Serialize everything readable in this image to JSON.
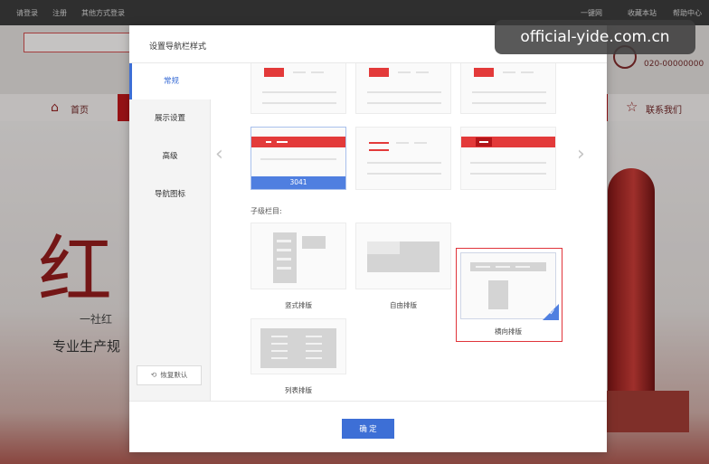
{
  "background_page": {
    "topbar_links": [
      "请登录",
      "注册",
      "其他方式登录"
    ],
    "topbar_right": [
      "一键网",
      "收藏本站",
      "帮助中心"
    ],
    "phone": "020-00000000",
    "nav_home": "首页",
    "nav_contact": "联系我们",
    "hero_calligraphy": "红",
    "hero_tagline": "一社红",
    "hero_subtitle": "专业生产规"
  },
  "dialog": {
    "title": "设置导航栏样式",
    "sidebar": {
      "items": [
        "常规",
        "展示设置",
        "高级",
        "导航图标"
      ],
      "active_index": 0,
      "reset_label": "恢复默认"
    },
    "style_presets": {
      "selected_label": "3041"
    },
    "sub_section_label": "子级栏目:",
    "layouts": [
      {
        "label": "竖式排版",
        "selected": false
      },
      {
        "label": "自由排版",
        "selected": false
      },
      {
        "label": "横向排版",
        "selected": true
      },
      {
        "label": "列表排版",
        "selected": false
      }
    ],
    "confirm_label": "确 定",
    "accent_color": "#3d6fd6",
    "selection_color": "#e0343a"
  },
  "watermark": "official-yide.com.cn"
}
